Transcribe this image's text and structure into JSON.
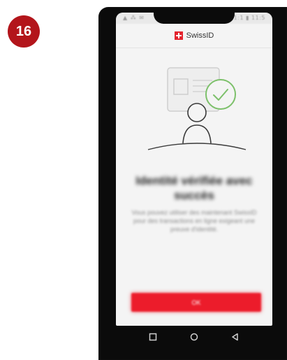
{
  "step": {
    "number": "16"
  },
  "status_bar": {
    "left": "▲ ⁂ ✉",
    "right": "⚡ 11:1 ▮ 11:5"
  },
  "app": {
    "brand": "SwissID"
  },
  "screen": {
    "title": "Identité vérifiée avec succès",
    "description": "Vous pouvez utiliser des maintenant SwissID pour des transactions en ligne exigeant une preuve d'identité.",
    "primary_button": "OK"
  },
  "colors": {
    "brand_red": "#e3232d",
    "step_badge": "#b3151b",
    "check_green": "#7cc06a"
  },
  "icons": {
    "nav_recents": "square-icon",
    "nav_home": "circle-icon",
    "nav_back": "triangle-back-icon",
    "illustration": "identity-verified-illustration"
  }
}
